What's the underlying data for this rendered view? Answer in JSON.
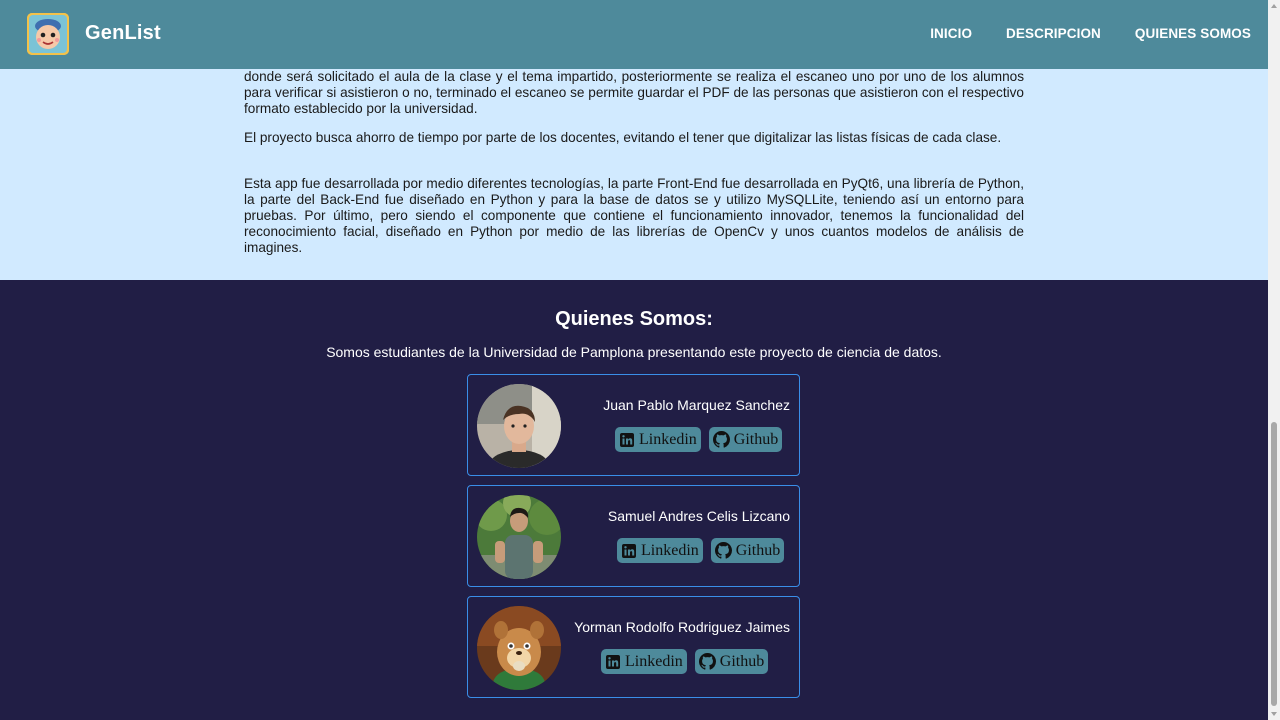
{
  "nav": {
    "brand": "GenList",
    "links": [
      "INICIO",
      "DESCRIPCION",
      "QUIENES SOMOS"
    ]
  },
  "description": {
    "paragraphs": [
      "donde será solicitado el aula de la clase y el tema impartido, posteriormente se realiza el escaneo uno por uno de los alumnos para verificar si asistieron o no, terminado el escaneo se permite guardar el PDF de las personas que asistieron con el respectivo formato establecido por la universidad.",
      "El proyecto busca ahorro de tiempo por parte de los docentes, evitando el tener que digitalizar las listas físicas de cada clase.",
      "Esta app fue desarrollada por medio diferentes tecnologías, la parte Front-End fue desarrollada en PyQt6, una librería de Python, la parte del Back-End fue diseñado en Python y para la base de datos se y utilizo MySQLLite, teniendo así un entorno para pruebas. Por último, pero siendo el componente que contiene el funcionamiento innovador, tenemos la funcionalidad del reconocimiento facial, diseñado en Python por medio de las librerías de OpenCv y unos cuantos modelos de análisis de imagines."
    ]
  },
  "team": {
    "title": "Quienes Somos:",
    "subtitle": "Somos estudiantes de la Universidad de Pamplona presentando este proyecto de ciencia de datos.",
    "members": [
      {
        "name": "Juan Pablo Marquez Sanchez",
        "linkedin_label": "Linkedin",
        "github_label": "Github"
      },
      {
        "name": "Samuel Andres Celis Lizcano",
        "linkedin_label": "Linkedin",
        "github_label": "Github"
      },
      {
        "name": "Yorman Rodolfo Rodriguez Jaimes",
        "linkedin_label": "Linkedin",
        "github_label": "Github"
      }
    ]
  },
  "colors": {
    "navbar": "#4e8a9b",
    "description_bg": "#d1eaff",
    "team_bg": "#211e45",
    "card_border": "#3a8ee8"
  }
}
